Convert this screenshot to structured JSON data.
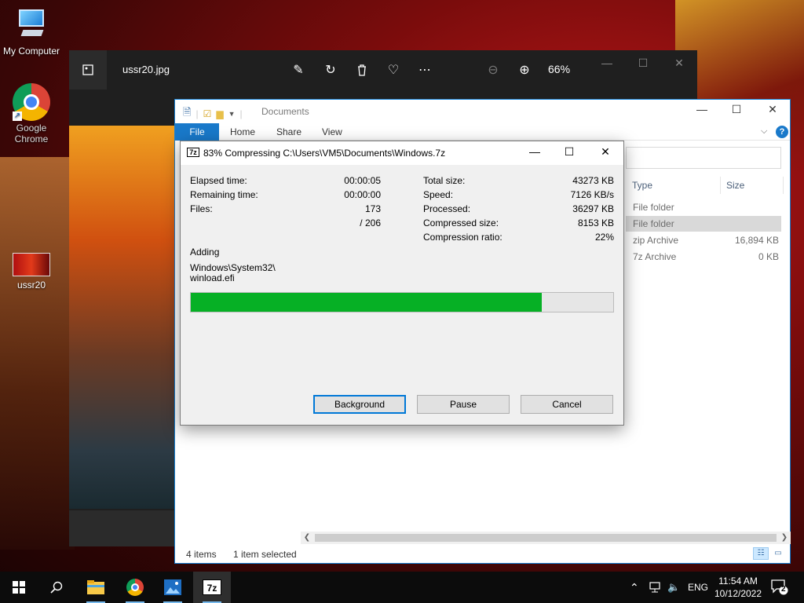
{
  "desktop": {
    "icons": [
      {
        "label": "My Computer"
      },
      {
        "label": "Google Chrome"
      },
      {
        "label": "ussr20"
      }
    ]
  },
  "photo_viewer": {
    "title": "ussr20.jpg",
    "zoom": "66%",
    "tools": [
      "edit-icon",
      "rotate-icon",
      "delete-icon",
      "favorite-icon",
      "more-icon",
      "zoom-out-icon",
      "zoom-in-icon"
    ]
  },
  "explorer": {
    "title": "Documents",
    "ribbon": {
      "file": "File",
      "home": "Home",
      "share": "Share",
      "view": "View",
      "help": "?"
    },
    "columns": {
      "type": "Type",
      "size": "Size"
    },
    "rows": [
      {
        "type": "File folder",
        "size": ""
      },
      {
        "type": "File folder",
        "size": ""
      },
      {
        "type": "zip Archive",
        "size": "16,894 KB"
      },
      {
        "type": "7z Archive",
        "size": "0 KB"
      }
    ],
    "status": {
      "items": "4 items",
      "selected": "1 item selected"
    }
  },
  "sevenzip": {
    "title": "83% Compressing C:\\Users\\VM5\\Documents\\Windows.7z",
    "icon_text": "7z",
    "elapsed_label": "Elapsed time:",
    "elapsed": "00:00:05",
    "remaining_label": "Remaining time:",
    "remaining": "00:00:00",
    "files_label": "Files:",
    "files": "173",
    "files_total": "/ 206",
    "total_size_label": "Total size:",
    "total_size": "43273 KB",
    "speed_label": "Speed:",
    "speed": "7126 KB/s",
    "processed_label": "Processed:",
    "processed": "36297 KB",
    "compressed_label": "Compressed size:",
    "compressed": "8153 KB",
    "ratio_label": "Compression ratio:",
    "ratio": "22%",
    "adding_label": "Adding",
    "path_line1": "Windows\\System32\\",
    "path_line2": "winload.efi",
    "progress_percent": 83,
    "buttons": {
      "background": "Background",
      "pause": "Pause",
      "cancel": "Cancel"
    }
  },
  "taskbar": {
    "lang": "ENG",
    "time": "11:54 AM",
    "date": "10/12/2022",
    "notifications": "2",
    "seven_zip_label": "7z"
  },
  "colors": {
    "accent": "#1979ca",
    "progress": "#06b025"
  }
}
